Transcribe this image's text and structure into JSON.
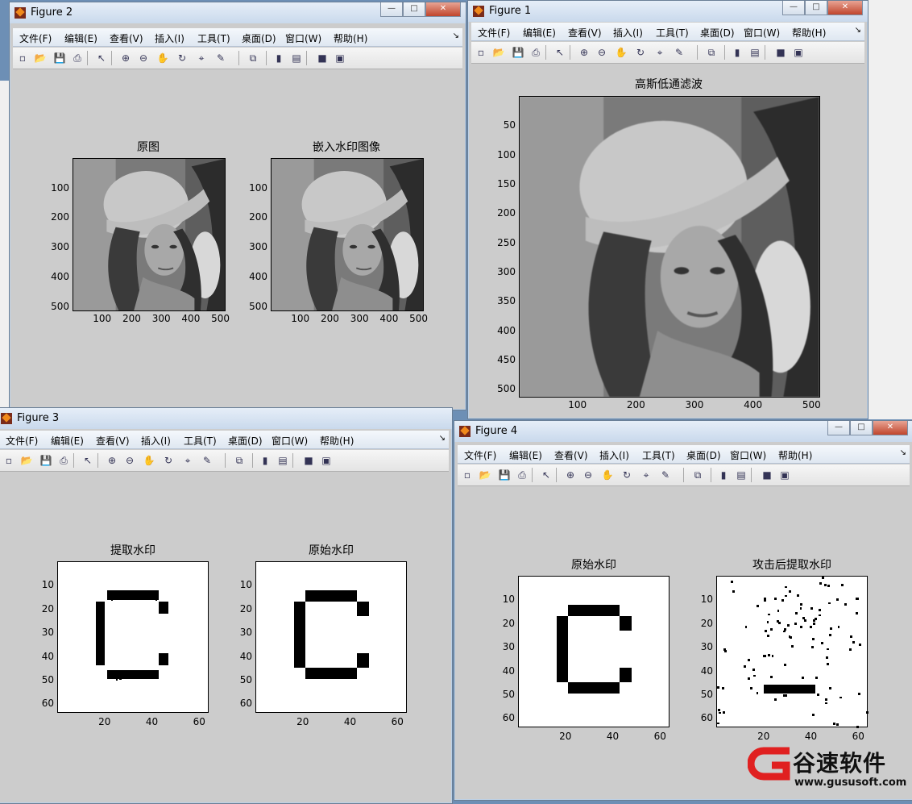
{
  "menu_labels": [
    "文件(F)",
    "编辑(E)",
    "查看(V)",
    "插入(I)",
    "工具(T)",
    "桌面(D)",
    "窗口(W)",
    "帮助(H)"
  ],
  "window_buttons": {
    "minimize": "—",
    "maximize": "□",
    "close": "✕"
  },
  "toolbar_icons": [
    "new-figure-icon",
    "open-icon",
    "save-icon",
    "print-icon",
    "pointer-icon",
    "zoom-in-icon",
    "zoom-out-icon",
    "pan-icon",
    "rotate3d-icon",
    "data-cursor-icon",
    "brush-icon",
    "link-plot-icon",
    "colorbar-icon",
    "legend-icon",
    "hide-plot-tools-icon",
    "show-plot-tools-icon"
  ],
  "figure2": {
    "title": "Figure 2",
    "axes1_title": "原图",
    "axes2_title": "嵌入水印图像",
    "yticks": [
      "100",
      "200",
      "300",
      "400",
      "500"
    ],
    "xticks": [
      "100",
      "200",
      "300",
      "400",
      "500"
    ]
  },
  "figure1": {
    "title": "Figure 1",
    "axes_title": "高斯低通滤波",
    "yticks": [
      "50",
      "100",
      "150",
      "200",
      "250",
      "300",
      "350",
      "400",
      "450",
      "500"
    ],
    "xticks": [
      "100",
      "200",
      "300",
      "400",
      "500"
    ]
  },
  "figure3": {
    "title": "Figure 3",
    "axes1_title": "提取水印",
    "axes2_title": "原始水印",
    "yticks": [
      "10",
      "20",
      "30",
      "40",
      "50",
      "60"
    ],
    "xticks": [
      "20",
      "40",
      "60"
    ]
  },
  "figure4": {
    "title": "Figure 4",
    "axes1_title": "原始水印",
    "axes2_title": "攻击后提取水印",
    "yticks": [
      "10",
      "20",
      "30",
      "40",
      "50",
      "60"
    ],
    "xticks": [
      "20",
      "40",
      "60"
    ]
  },
  "watermark_logo": {
    "brand": "谷速软件",
    "url": "www.gususoft.com"
  }
}
